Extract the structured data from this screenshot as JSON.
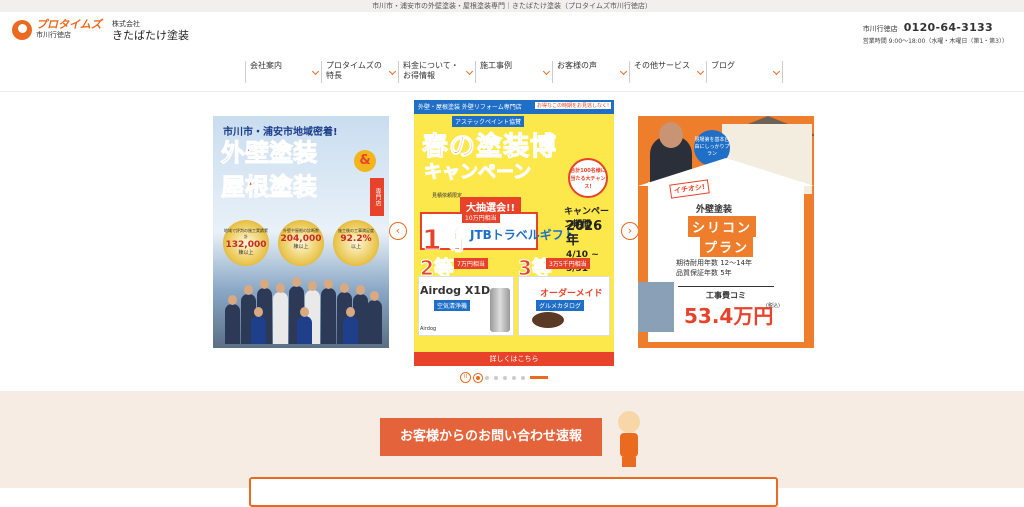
{
  "topbar": {
    "text": "市川市・浦安市の外壁塗装・屋根塗装専門｜きたばたけ塗装（プロタイムズ市川行徳店）"
  },
  "header": {
    "logo_main": "プロタイムズ",
    "logo_sub": "市川行徳店",
    "company_small": "株式会社",
    "company_name": "きたばたけ塗装",
    "store_label": "市川行徳店",
    "phone": "0120-64-3133",
    "hours": "営業時間 9:00～18:00（水曜・木曜日（第1・第3））"
  },
  "nav": {
    "items": [
      {
        "label": "会社案内"
      },
      {
        "label": "プロタイムズの特長"
      },
      {
        "label": "料金について・お得情報"
      },
      {
        "label": "施工事例"
      },
      {
        "label": "お客様の声"
      },
      {
        "label": "その他サービス"
      },
      {
        "label": "ブログ"
      }
    ]
  },
  "slides": {
    "b1": {
      "headline": "市川市・浦安市地域密着!",
      "line1": "外壁塗装",
      "amp": "&",
      "line2": "屋根塗装",
      "badge": "専門店",
      "medals": [
        {
          "title": "地域で評判の施工実績累計",
          "value": "132,000",
          "unit": "棟以上"
        },
        {
          "title": "外壁や屋根の診断数",
          "value": "204,000",
          "unit": "棟以上"
        },
        {
          "title": "施工後の工事満足度",
          "value": "92.2%",
          "unit": "以上"
        }
      ]
    },
    "b2": {
      "top_left": "外壁・屋根塗装 外壁リフォーム専門店",
      "top_right": "お得なこの時期をお見逃しなく!",
      "sub": "アステックペイント協賛",
      "title1": "春の塗装博",
      "title2": "キャンペーン",
      "badge": "合計100名様に当たる大チャンス!",
      "note": "見積依頼限定",
      "lottery": "大抽選会!!",
      "grade1": "1等",
      "prize1_amount": "10万円相当",
      "prize1_name": "JTBトラベルギフト",
      "date_label": "キャンペーン期間",
      "date_year": "2026年",
      "date_range": "4/10 ~ 5/31",
      "grade2": "2等",
      "prize2_amount": "7万円相当",
      "grade3": "3等",
      "prize3_amount": "3万5千円相当",
      "prize2_name": "Airdog X1D",
      "prize2_desc": "空気清浄機",
      "prize3_name": "オーダーメイド ハート",
      "prize3_desc": "グルメカタログ",
      "brand": "Airdog",
      "footer": "詳しくはこちら"
    },
    "b3": {
      "bubble": "現場第を基本自由にしっかりプラン",
      "ioshi": "イチオシ!",
      "paint": "外壁塗装",
      "plan1": "シリコン",
      "plan2": "プラン",
      "years1": "期待耐用年数 12～14年",
      "years2": "品質保証年数 5年",
      "fee": "工事費コミ",
      "price": "53.4万円",
      "tax": "(税込)"
    },
    "prev": "‹",
    "next": "›",
    "pause": "II"
  },
  "news": {
    "title": "お客様からのお問い合わせ速報"
  },
  "colors": {
    "accent": "#ea6a1f",
    "news_bg": "#f7ece4",
    "news_title_bg": "#e5633a"
  }
}
